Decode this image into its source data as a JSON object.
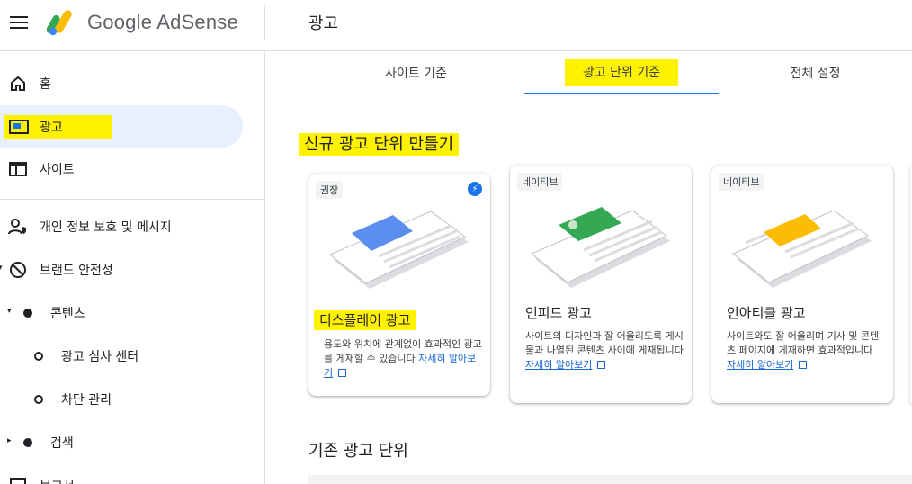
{
  "app": {
    "brand": "Google AdSense",
    "page_title": "광고"
  },
  "sidebar": {
    "items": [
      {
        "label": "홈",
        "icon": "home-icon"
      },
      {
        "label": "광고",
        "icon": "ads-icon",
        "active": true
      },
      {
        "label": "사이트",
        "icon": "sites-icon"
      },
      {
        "label": "개인 정보 보호 및 메시지",
        "icon": "privacy-icon"
      },
      {
        "label": "브랜드 안전성",
        "icon": "block-icon"
      },
      {
        "label": "콘텐츠",
        "icon": "dot-icon"
      },
      {
        "label": "광고 심사 센터",
        "icon": "ring-icon"
      },
      {
        "label": "차단 관리",
        "icon": "ring-icon"
      },
      {
        "label": "검색",
        "icon": "dot-icon"
      },
      {
        "label": "보고서",
        "icon": "report-icon"
      }
    ]
  },
  "tabs": [
    {
      "label": "사이트 기준"
    },
    {
      "label": "광고 단위 기준",
      "active": true
    },
    {
      "label": "전체 설정"
    }
  ],
  "new_section_title": "신규 광고 단위 만들기",
  "existing_section_title": "기존 광고 단위",
  "cards": [
    {
      "badge": "권장",
      "title": "디스플레이 광고",
      "desc": "용도와 위치에 관계없이 효과적인 광고를 게재할 수 있습니다",
      "link": "자세히 알아보기",
      "accent": "#5b8def"
    },
    {
      "badge": "네이티브",
      "title": "인피드 광고",
      "desc": "사이트의 디자인과 잘 어울리도록 게시물과 나열된 콘텐츠 사이에 게재됩니다",
      "link": "자세히 알아보기",
      "accent": "#34a853"
    },
    {
      "badge": "네이티브",
      "title": "인아티클 광고",
      "desc": "사이트와도 잘 어울리며 기사 및 콘텐츠 페이지에 게재하면 효과적입니다",
      "link": "자세히 알아보기",
      "accent": "#fbbc04"
    }
  ],
  "colors": {
    "highlight": "#fff200",
    "accent": "#1a73e8",
    "active_bg": "#e8f0fe"
  }
}
